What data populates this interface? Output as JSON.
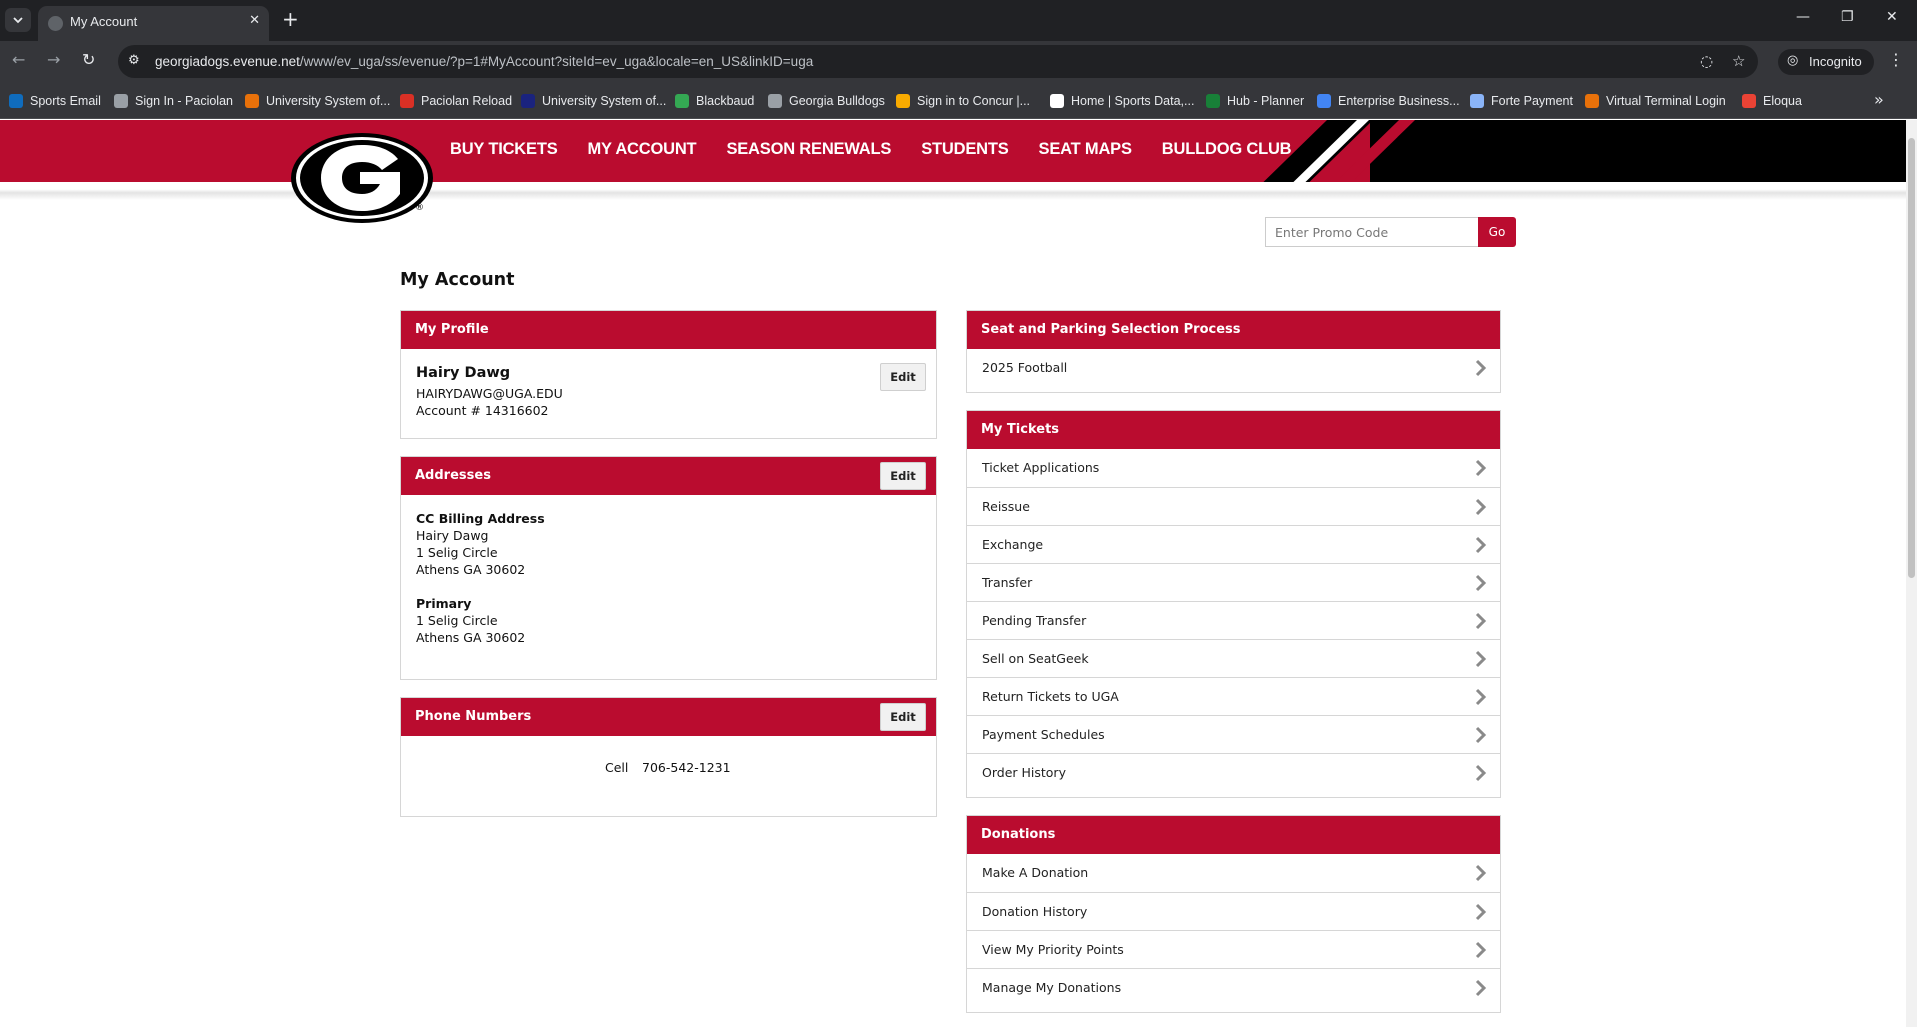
{
  "browser": {
    "tab_title": "My Account",
    "url_host": "georgiadogs.evenue.net",
    "url_path": "/www/ev_uga/ss/evenue/?p=1#MyAccount?siteId=ev_uga&locale=en_US&linkID=uga",
    "incognito_label": "Incognito",
    "bookmarks": [
      {
        "label": "Sports Email",
        "color": "#0f6cbd"
      },
      {
        "label": "Sign In - Paciolan",
        "color": "#9aa0a6"
      },
      {
        "label": "University System of...",
        "color": "#e8710a"
      },
      {
        "label": "Paciolan Reload",
        "color": "#d93025"
      },
      {
        "label": "University System of...",
        "color": "#1a237e"
      },
      {
        "label": "Blackbaud",
        "color": "#34a853"
      },
      {
        "label": "Georgia Bulldogs",
        "color": "#9aa0a6"
      },
      {
        "label": "Sign in to Concur |...",
        "color": "#f9ab00"
      },
      {
        "label": "Home | Sports Data,...",
        "color": "#ffffff"
      },
      {
        "label": "Hub - Planner",
        "color": "#188038"
      },
      {
        "label": "Enterprise Business...",
        "color": "#4285f4"
      },
      {
        "label": "Forte Payment",
        "color": "#8ab4f8"
      },
      {
        "label": "Virtual Terminal Login",
        "color": "#e8710a"
      },
      {
        "label": "Eloqua",
        "color": "#ea4335"
      }
    ]
  },
  "site": {
    "brand_red": "#ba0c2f",
    "nav": [
      "BUY TICKETS",
      "MY ACCOUNT",
      "SEASON RENEWALS",
      "STUDENTS",
      "SEAT MAPS",
      "BULLDOG CLUB"
    ],
    "promo": {
      "placeholder": "Enter Promo Code",
      "button": "Go"
    },
    "page_title": "My Account"
  },
  "profile": {
    "title": "My Profile",
    "edit": "Edit",
    "name": "Hairy Dawg",
    "email": "HAIRYDAWG@UGA.EDU",
    "account": "Account # 14316602"
  },
  "addresses": {
    "title": "Addresses",
    "edit": "Edit",
    "items": [
      {
        "heading": "CC Billing Address",
        "lines": [
          "Hairy Dawg",
          "1 Selig Circle",
          "Athens GA 30602"
        ]
      },
      {
        "heading": "Primary",
        "lines": [
          "1 Selig Circle",
          "Athens GA 30602"
        ]
      }
    ]
  },
  "phones": {
    "title": "Phone Numbers",
    "edit": "Edit",
    "type": "Cell",
    "number": "706-542-1231"
  },
  "seat_parking": {
    "title": "Seat and Parking Selection Process",
    "items": [
      "2025 Football"
    ]
  },
  "tickets": {
    "title": "My Tickets",
    "items": [
      "Ticket Applications",
      "Reissue",
      "Exchange",
      "Transfer",
      "Pending Transfer",
      "Sell on SeatGeek",
      "Return Tickets to UGA",
      "Payment Schedules",
      "Order History"
    ]
  },
  "donations": {
    "title": "Donations",
    "items": [
      "Make A Donation",
      "Donation History",
      "View My Priority Points",
      "Manage My Donations"
    ]
  }
}
